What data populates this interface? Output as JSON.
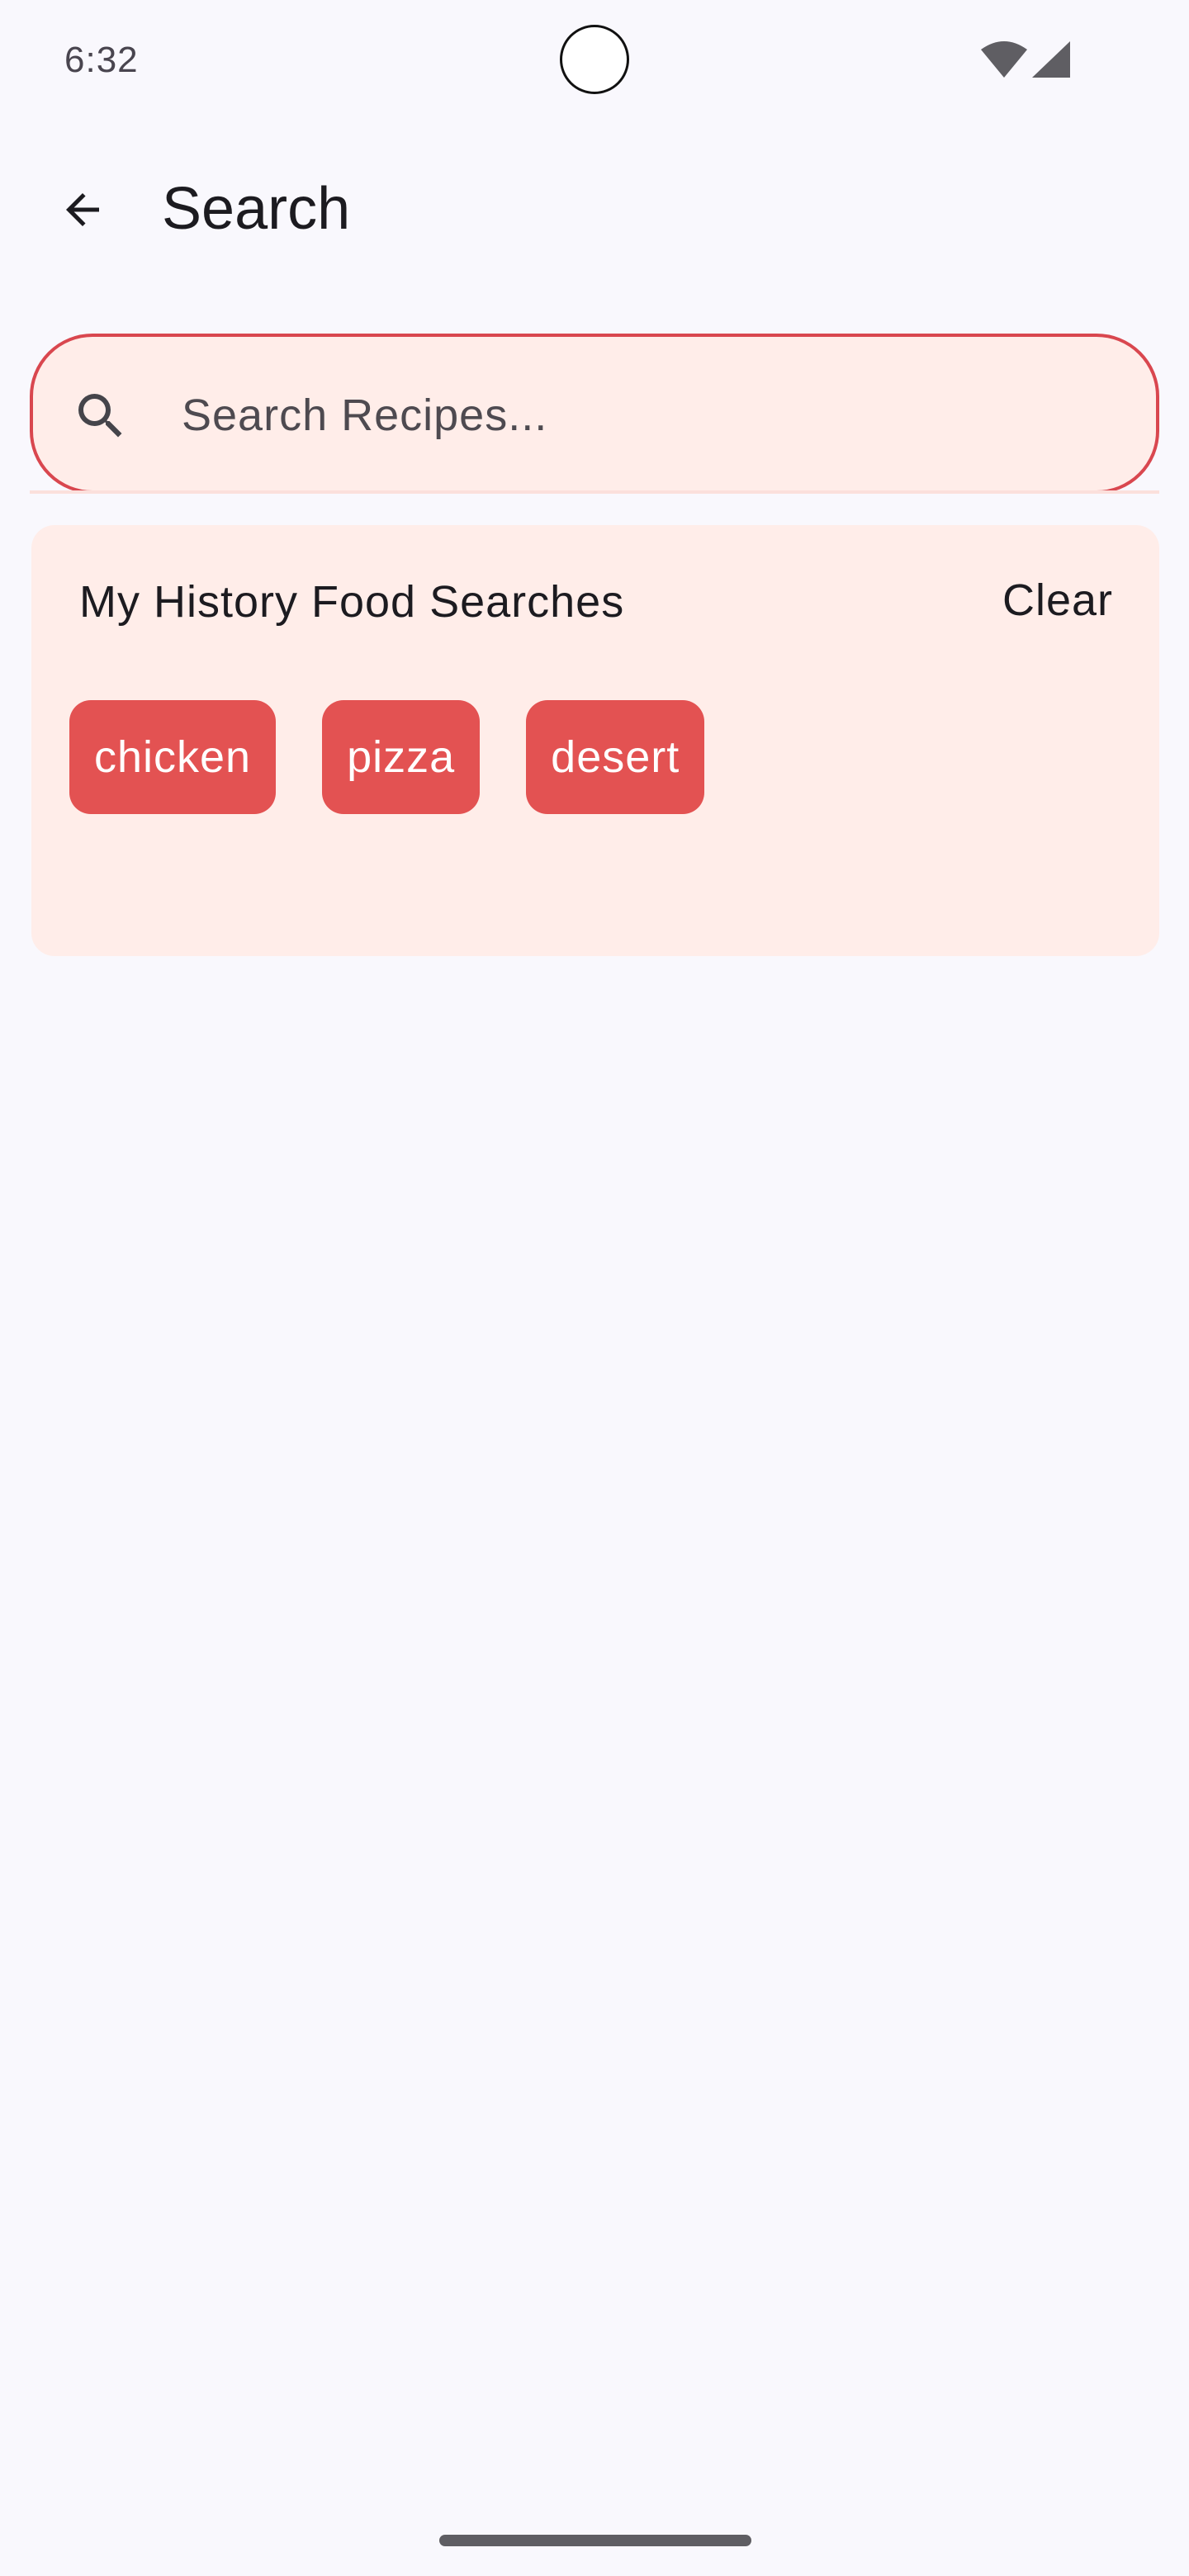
{
  "status_bar": {
    "time": "6:32",
    "icons": [
      "wifi-icon",
      "signal-icon"
    ]
  },
  "app_bar": {
    "back_icon": "arrow-back-icon",
    "title": "Search"
  },
  "search": {
    "icon": "search-icon",
    "value": "",
    "placeholder": "Search Recipes..."
  },
  "history": {
    "title": "My History Food Searches",
    "clear_label": "Clear",
    "chips": [
      "chicken",
      "pizza",
      "desert"
    ]
  },
  "colors": {
    "accent": "#E35252",
    "outline": "#D9474F",
    "surface_container": "#FFEDE9",
    "background": "#F9F8FD",
    "on_surface": "#1C1B20"
  }
}
